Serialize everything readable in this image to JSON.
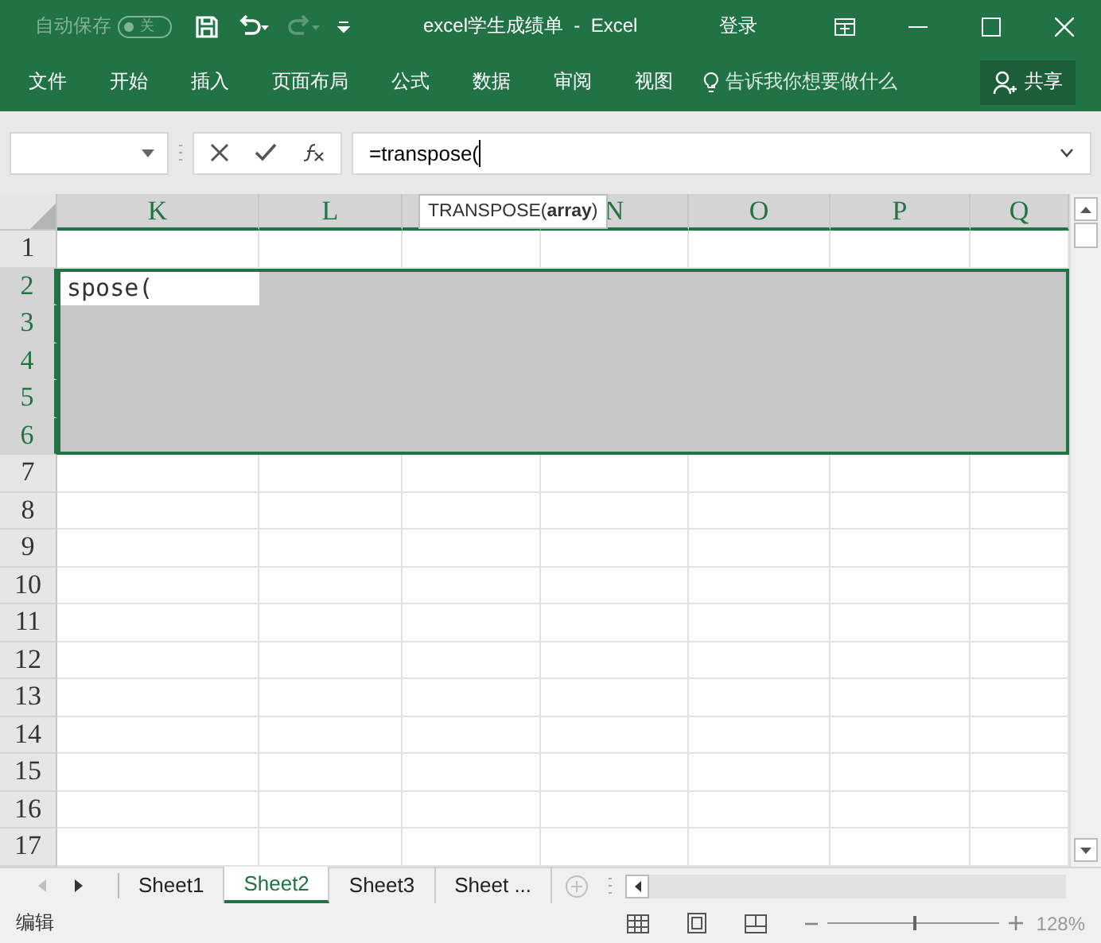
{
  "title_bar": {
    "autosave_label": "自动保存",
    "autosave": {
      "on": false,
      "label": "关"
    },
    "redo": {
      "disabled": true
    },
    "title": "excel学生成绩单  -  Excel",
    "sign_in": "登录"
  },
  "ribbon_tabs": [
    {
      "label": "文件"
    },
    {
      "label": "开始"
    },
    {
      "label": "插入"
    },
    {
      "label": "页面布局"
    },
    {
      "label": "公式"
    },
    {
      "label": "数据"
    },
    {
      "label": "审阅"
    },
    {
      "label": "视图"
    }
  ],
  "tell_me": "告诉我你想要做什么",
  "share": "共享",
  "formula_bar": {
    "value": "=transpose("
  },
  "tooltip": "TRANSPOSE(**array**)",
  "columns": [
    {
      "label": "K",
      "selected": true
    },
    {
      "label": "L",
      "selected": true
    },
    {
      "selected": true
    },
    {
      "label": "N",
      "selected": true
    },
    {
      "label": "O",
      "selected": true
    },
    {
      "label": "P",
      "selected": true
    },
    {
      "label": "Q",
      "selected": true
    }
  ],
  "rows": [
    {
      "label": "1",
      "selected": false
    },
    {
      "label": "2",
      "selected": true
    },
    {
      "label": "3",
      "selected": true
    },
    {
      "label": "4",
      "selected": true
    },
    {
      "label": "5",
      "selected": true
    },
    {
      "label": "6",
      "selected": true
    },
    {
      "label": "7",
      "selected": false
    },
    {
      "label": "8",
      "selected": false
    },
    {
      "label": "9",
      "selected": false
    },
    {
      "label": "10",
      "selected": false
    },
    {
      "label": "11",
      "selected": false
    },
    {
      "label": "12",
      "selected": false
    },
    {
      "label": "13",
      "selected": false
    },
    {
      "label": "14",
      "selected": false
    },
    {
      "label": "15",
      "selected": false
    },
    {
      "label": "16",
      "selected": false
    },
    {
      "label": "17",
      "selected": false
    }
  ],
  "active_cell": {
    "text": "spose("
  },
  "sheet_tabs": [
    {
      "label": "Sheet1",
      "selected": false
    },
    {
      "label": "Sheet2",
      "selected": true
    },
    {
      "label": "Sheet3",
      "selected": false
    },
    {
      "label": "Sheet ...",
      "selected": false
    }
  ],
  "status_bar": {
    "mode": "编辑",
    "zoom": {
      "level": 0.5,
      "reading": "128%"
    }
  }
}
